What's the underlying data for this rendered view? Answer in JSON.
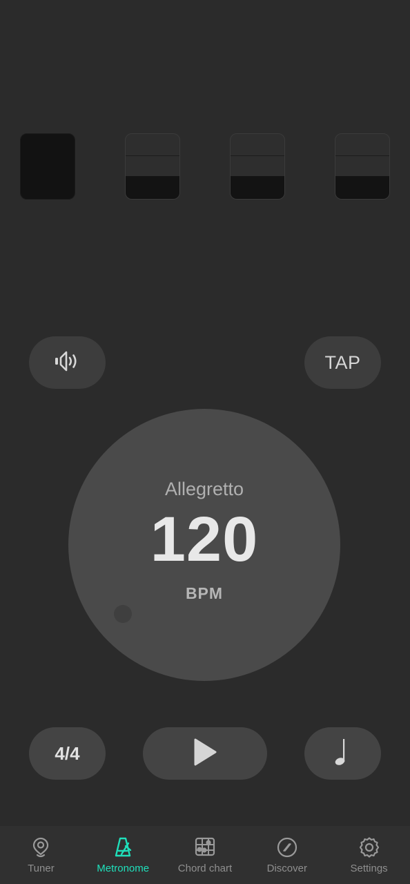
{
  "app": {
    "screen": "Metronome",
    "background_color": "#2b2b2b",
    "accent_color": "#1fe0bb"
  },
  "beats": {
    "count": 4,
    "items": [
      {
        "index": 1,
        "accent": true,
        "label": "beat-1"
      },
      {
        "index": 2,
        "accent": false,
        "label": "beat-2"
      },
      {
        "index": 3,
        "accent": false,
        "label": "beat-3"
      },
      {
        "index": 4,
        "accent": false,
        "label": "beat-4"
      }
    ]
  },
  "controls": {
    "volume_icon": "speaker-icon",
    "tap_label": "TAP",
    "time_signature": "4/4",
    "play_icon": "play-icon",
    "note_value_icon": "quarter-note-icon"
  },
  "dial": {
    "tempo_name": "Allegretto",
    "bpm": "120",
    "unit": "BPM",
    "knob": "dial-knob"
  },
  "nav": {
    "items": [
      {
        "label": "Tuner",
        "icon": "tuning-fork-icon",
        "active": false
      },
      {
        "label": "Metronome",
        "icon": "metronome-icon",
        "active": true
      },
      {
        "label": "Chord chart",
        "icon": "chord-chart-icon",
        "active": false
      },
      {
        "label": "Discover",
        "icon": "compass-icon",
        "active": false
      },
      {
        "label": "Settings",
        "icon": "gear-icon",
        "active": false
      }
    ]
  }
}
